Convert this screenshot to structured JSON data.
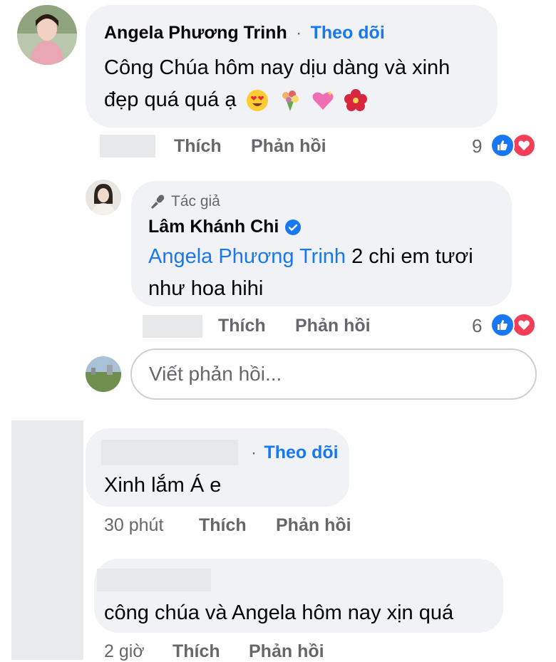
{
  "colors": {
    "bubble": "#f0f2f5",
    "link": "#1877f2",
    "muted": "#65676b",
    "like": "#1877f2",
    "love": "#f33e58",
    "verified": "#1877f2"
  },
  "comments": [
    {
      "author": "Angela Phương Trinh",
      "follow": "Theo dõi",
      "separator": "·",
      "text": "Công Chúa hôm nay dịu dàng và xinh đẹp quá quá ạ",
      "emojis": [
        "smiling-face-heart-eyes-icon",
        "bouquet-icon",
        "sparkling-heart-icon",
        "hibiscus-icon"
      ],
      "actions": {
        "like": "Thích",
        "reply": "Phản hồi"
      },
      "reaction_count": "9",
      "reactions": [
        "like-icon",
        "love-icon"
      ],
      "reply": {
        "badge": "Tác giả",
        "badge_icon": "microphone-icon",
        "author": "Lâm Khánh Chi",
        "verified_icon": "verified-badge-icon",
        "mention": "Angela Phương Trinh",
        "text": " 2 chi em tươi như hoa hihi",
        "actions": {
          "like": "Thích",
          "reply": "Phản hồi"
        },
        "reaction_count": "6",
        "reactions": [
          "like-icon",
          "love-icon"
        ]
      },
      "reply_input": {
        "placeholder": "Viết phản hồi..."
      }
    },
    {
      "follow": "Theo dõi",
      "separator": "·",
      "text": "Xinh lắm Á e",
      "time": "30 phút",
      "actions": {
        "like": "Thích",
        "reply": "Phản hồi"
      }
    },
    {
      "text": "công chúa và Angela hôm nay xịn quá",
      "time": "2 giờ",
      "actions": {
        "like": "Thích",
        "reply": "Phản hồi"
      }
    }
  ]
}
